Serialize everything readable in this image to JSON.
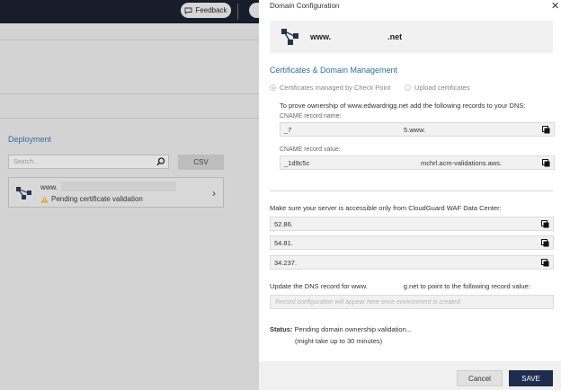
{
  "background": {
    "feedback_label": "Feedback",
    "deployment_title": "Deployment",
    "search_placeholder": "Search...",
    "csv_label": "CSV",
    "card_name": "www.",
    "card_status": "Pending certificate validation"
  },
  "dialog": {
    "title": "Domain Configuration",
    "domain_prefix": "www.",
    "domain_suffix": ".net",
    "section_title": "Certificates & Domain Management",
    "radio_managed": "Certificates managed by Check Point",
    "radio_upload": "Upload certificates",
    "prove_text": "To prove ownership of www.edwardrigg.net add the following records to your DNS:",
    "cname_name_label": "CNAME record name:",
    "cname_name_value_start": "_7",
    "cname_name_value_end": "5.www.",
    "cname_value_label": "CNAME record value:",
    "cname_value_start": "_1d9c5c",
    "cname_value_end": "mchrl.acm-validations.aws.",
    "accessible_text": "Make sure your server is accessible only from CloudGuard WAF Data Center:",
    "ips": [
      "52.86.",
      "54.81.",
      "34.237."
    ],
    "update_text_start": "Update the DNS record for www.",
    "update_text_end": "g.net to point to the following record value:",
    "record_placeholder": "Record configuration will appear here once environment is created",
    "status_label": "Status:",
    "status_value": "Pending domain ownership validation...",
    "status_note": "(might take up to 30 minutes)",
    "cancel_label": "Cancel",
    "save_label": "SAVE"
  },
  "colors": {
    "accent_blue": "#2f6da3",
    "save_button": "#1e2d4d",
    "topbar": "#171d2b"
  },
  "icons": [
    "feedback-icon",
    "search-icon",
    "deployment-icon",
    "warning-icon",
    "chevron-right-icon",
    "close-icon",
    "copy-icon"
  ]
}
